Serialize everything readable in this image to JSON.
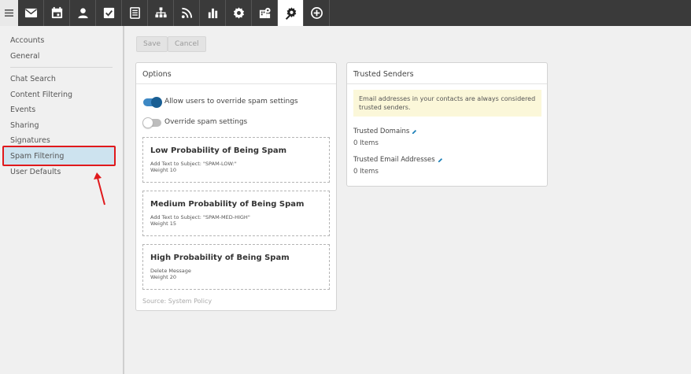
{
  "topbar": {
    "icons": [
      "menu-icon",
      "mail-icon",
      "calendar-icon",
      "contacts-icon",
      "tasks-icon",
      "notes-icon",
      "sitemap-icon",
      "rss-icon",
      "reports-icon",
      "settings-icon",
      "domain-settings-icon",
      "admin-gear-icon",
      "add-icon"
    ],
    "active": "admin-gear-icon"
  },
  "sidebar": {
    "items": [
      {
        "label": "Accounts"
      },
      {
        "label": "General"
      },
      {
        "label": "Chat Search"
      },
      {
        "label": "Content Filtering"
      },
      {
        "label": "Events"
      },
      {
        "label": "Sharing"
      },
      {
        "label": "Signatures"
      },
      {
        "label": "Spam Filtering"
      },
      {
        "label": "User Defaults"
      }
    ],
    "selected": "Spam Filtering"
  },
  "toolbar": {
    "save_label": "Save",
    "cancel_label": "Cancel"
  },
  "options": {
    "title": "Options",
    "toggles": [
      {
        "label": "Allow users to override spam settings",
        "on": true
      },
      {
        "label": "Override spam settings",
        "on": false
      }
    ],
    "levels": [
      {
        "title": "Low Probability of Being Spam",
        "action": "Add Text to Subject: \"SPAM-LOW:\"",
        "weight": "Weight 10"
      },
      {
        "title": "Medium Probability of Being Spam",
        "action": "Add Text to Subject: \"SPAM-MED-HIGH\"",
        "weight": "Weight 15"
      },
      {
        "title": "High Probability of Being Spam",
        "action": "Delete Message",
        "weight": "Weight 20"
      }
    ],
    "source": "Source: System Policy"
  },
  "trusted": {
    "title": "Trusted Senders",
    "notice": "Email addresses in your contacts are always considered trusted senders.",
    "domains_label": "Trusted Domains",
    "domains_value": "0 Items",
    "emails_label": "Trusted Email Addresses",
    "emails_value": "0 Items"
  },
  "colors": {
    "accent": "#3d88c4",
    "highlight": "#e0191c",
    "selected_bg": "#cde3ef",
    "notice_bg": "#fbf7d9"
  }
}
